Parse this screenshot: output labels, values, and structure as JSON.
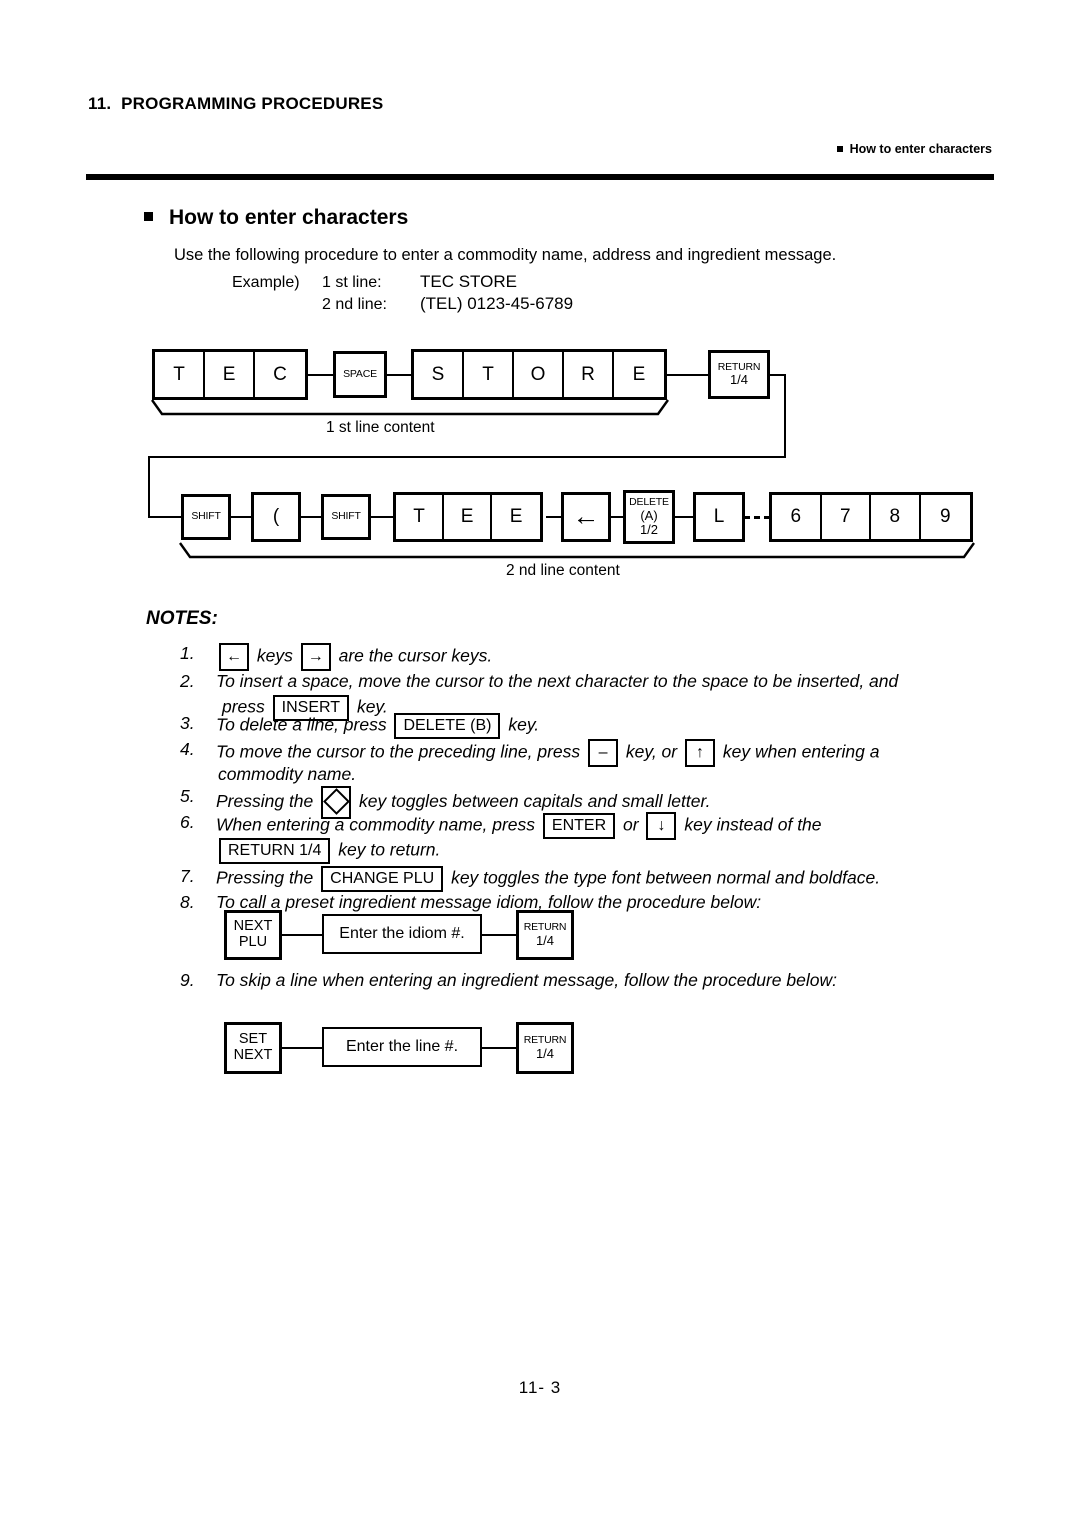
{
  "header": {
    "chapter": "11.  PROGRAMMING PROCEDURES",
    "right_label": "How to enter characters"
  },
  "section": {
    "heading": "How to enter characters",
    "intro": "Use the following procedure to enter a commodity name, address and ingredient message.",
    "example_label": "Example)",
    "line1_label": "1 st line:",
    "line1_value": "TEC STORE",
    "line2_label": "2 nd line:",
    "line2_value": "(TEL) 0123-45-6789"
  },
  "diagram1": {
    "caption": "1 st line content",
    "keys_group1": [
      "T",
      "E",
      "C"
    ],
    "space_key": "SPACE",
    "keys_group2": [
      "S",
      "T",
      "O",
      "R",
      "E"
    ],
    "return_key": {
      "line1": "RETURN",
      "line2": "1/4"
    }
  },
  "diagram2": {
    "caption": "2 nd line content",
    "shift1": "SHIFT",
    "paren": "(",
    "shift2": "SHIFT",
    "letters": [
      "T",
      "E",
      "E"
    ],
    "left_arrow": "←",
    "delete_key": {
      "line1": "DELETE",
      "line2": "(A)",
      "line3": "1/2"
    },
    "letter_l": "L",
    "digits": [
      "6",
      "7",
      "8",
      "9"
    ]
  },
  "notes": {
    "title": "NOTES:",
    "items": [
      {
        "num": "1.",
        "part1": "",
        "key1": "←",
        "part2": "keys",
        "key2": "→",
        "part3": "are the cursor keys."
      },
      {
        "num": "2.",
        "line1": "To insert a space, move the cursor to the next character to the space to be inserted, and",
        "line2_pre": "press",
        "line2_key": "INSERT",
        "line2_post": "key."
      },
      {
        "num": "3.",
        "pre": "To delete a line, press",
        "key": "DELETE (B)",
        "post": "key."
      },
      {
        "num": "4.",
        "pre": "To move the cursor to the preceding line, press",
        "key1": "–",
        "mid": "key, or",
        "key2": "↑",
        "post": "key   when   entering   a",
        "line2": "commodity name."
      },
      {
        "num": "5.",
        "pre": "Pressing the",
        "key": "diamond-key",
        "post": "key toggles between capitals and small letter."
      },
      {
        "num": "6.",
        "pre": "When entering a commodity name, press",
        "key1": "ENTER",
        "mid": "or",
        "key2": "↓",
        "post": "key instead of the",
        "line2_key": "RETURN 1/4",
        "line2_post": "key to return."
      },
      {
        "num": "7.",
        "pre": "Pressing the",
        "key": "CHANGE PLU",
        "post": "key toggles the type font between normal and boldface."
      },
      {
        "num": "8.",
        "text": "To call a preset ingredient message idiom, follow the procedure below:"
      },
      {
        "num": "9.",
        "text": "To skip a line when entering an ingredient message, follow the procedure below:"
      }
    ]
  },
  "diagram3": {
    "start_key": {
      "line1": "NEXT",
      "line2": "PLU"
    },
    "middle_box": "Enter the idiom #.",
    "end_key": {
      "line1": "RETURN",
      "line2": "1/4"
    }
  },
  "diagram4": {
    "start_key": {
      "line1": "SET",
      "line2": "NEXT"
    },
    "middle_box": "Enter the line #.",
    "end_key": {
      "line1": "RETURN",
      "line2": "1/4"
    }
  },
  "footer": {
    "page": "11- 3"
  }
}
